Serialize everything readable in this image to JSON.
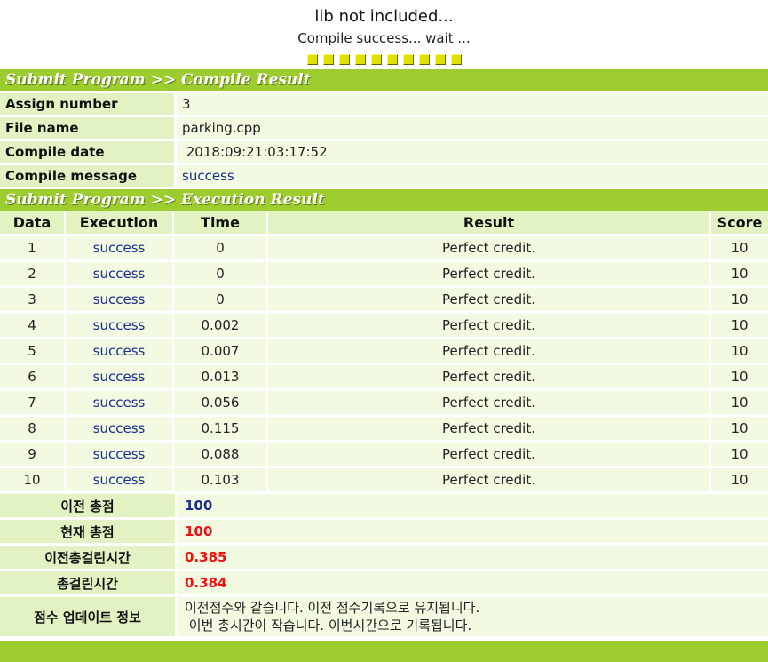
{
  "status": {
    "lib_message": "lib not included...",
    "compile_message": "Compile success... wait ...",
    "progress_blocks": 10
  },
  "compile_section": {
    "title": "Submit Program >> Compile Result",
    "rows": [
      {
        "label": "Assign number",
        "value": "3"
      },
      {
        "label": "File name",
        "value": "parking.cpp"
      },
      {
        "label": "Compile date",
        "value": " 2018:09:21:03:17:52"
      },
      {
        "label": "Compile message",
        "value": "success"
      }
    ]
  },
  "execution_section": {
    "title": "Submit Program >> Execution Result",
    "headers": [
      "Data",
      "Execution",
      "Time",
      "Result",
      "Score"
    ],
    "rows": [
      {
        "data": "1",
        "execution": "success",
        "time": "0",
        "result": "Perfect credit.",
        "score": "10"
      },
      {
        "data": "2",
        "execution": "success",
        "time": "0",
        "result": "Perfect credit.",
        "score": "10"
      },
      {
        "data": "3",
        "execution": "success",
        "time": "0",
        "result": "Perfect credit.",
        "score": "10"
      },
      {
        "data": "4",
        "execution": "success",
        "time": "0.002",
        "result": "Perfect credit.",
        "score": "10"
      },
      {
        "data": "5",
        "execution": "success",
        "time": "0.007",
        "result": "Perfect credit.",
        "score": "10"
      },
      {
        "data": "6",
        "execution": "success",
        "time": "0.013",
        "result": "Perfect credit.",
        "score": "10"
      },
      {
        "data": "7",
        "execution": "success",
        "time": "0.056",
        "result": "Perfect credit.",
        "score": "10"
      },
      {
        "data": "8",
        "execution": "success",
        "time": "0.115",
        "result": "Perfect credit.",
        "score": "10"
      },
      {
        "data": "9",
        "execution": "success",
        "time": "0.088",
        "result": "Perfect credit.",
        "score": "10"
      },
      {
        "data": "10",
        "execution": "success",
        "time": "0.103",
        "result": "Perfect credit.",
        "score": "10"
      }
    ]
  },
  "summary": {
    "previous_total_label": "이전 총점",
    "previous_total": "100",
    "current_total_label": "현재 총점",
    "current_total": "100",
    "previous_time_label": "이전총걸린시간",
    "previous_time": "0.385",
    "total_time_label": "총걸린시간",
    "total_time": "0.384",
    "update_info_label": "점수 업데이트 정보",
    "update_info_line1": "이전점수와 같습니다. 이전 점수기록으로 유지됩니다.",
    "update_info_line2": " 이번 총시간이 작습니다. 이번시간으로 기록됩니다."
  },
  "colors": {
    "header_bar": "#9ccc2e",
    "label_cell": "#e3f2c3",
    "value_cell": "#f3fae2",
    "link_blue": "#1c2e8c",
    "alert_red": "#f01010",
    "progress_block": "#e0e000"
  }
}
